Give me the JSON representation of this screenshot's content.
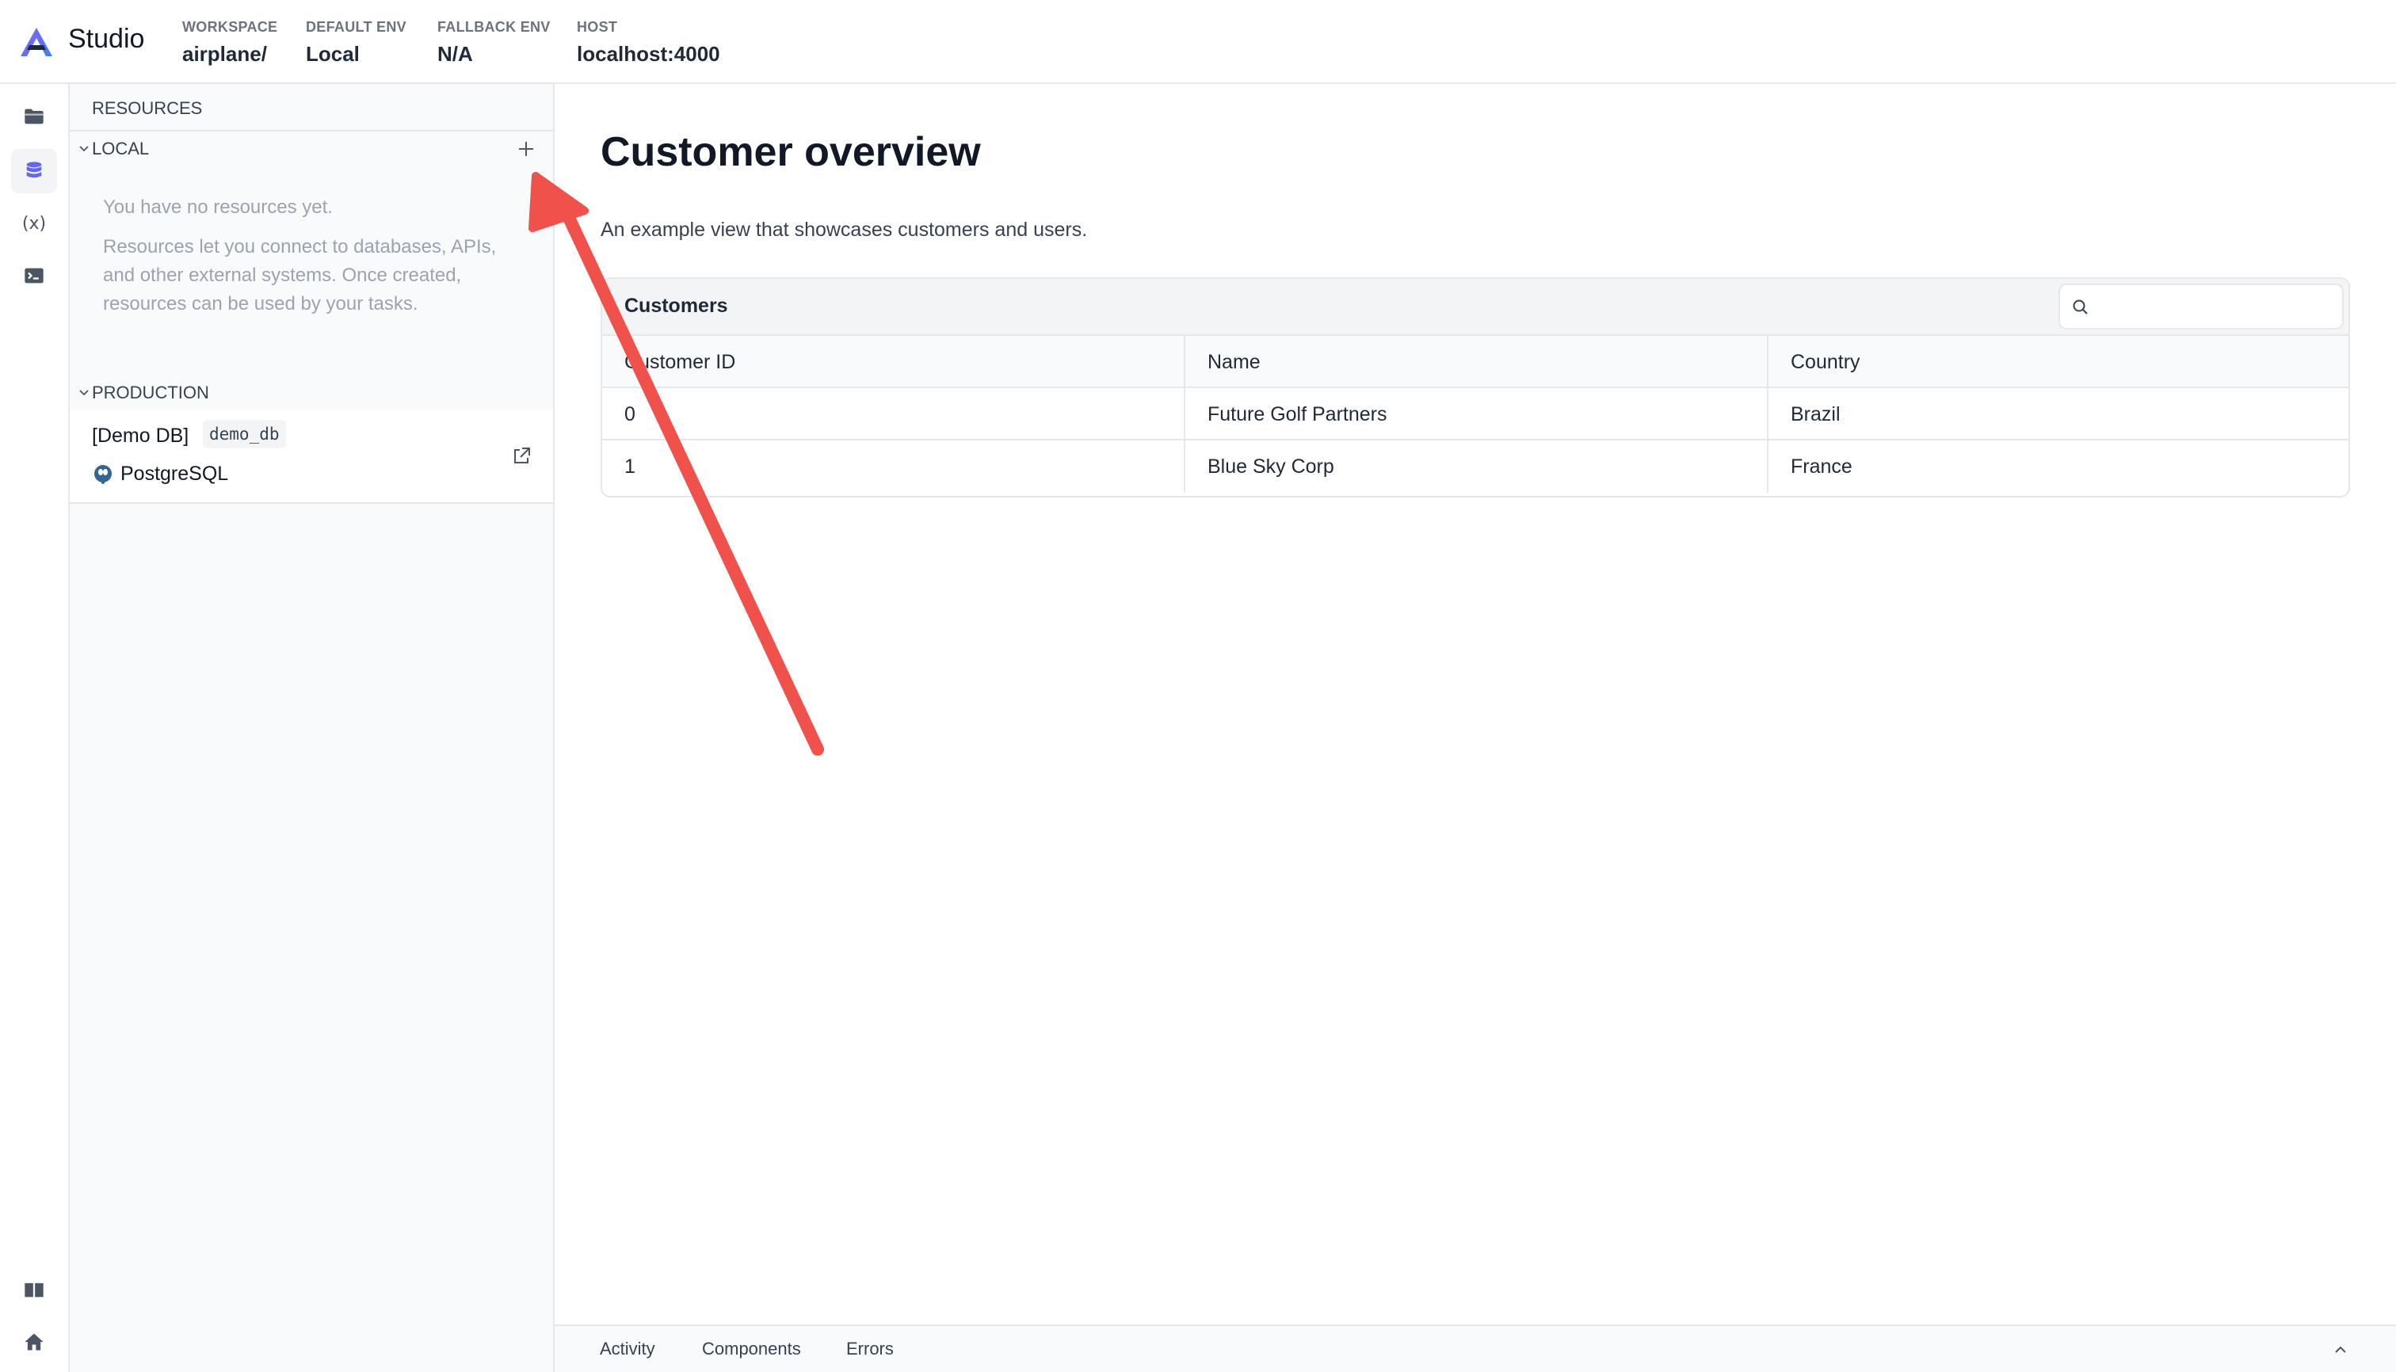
{
  "header": {
    "app_title": "Studio",
    "meta": [
      {
        "label": "WORKSPACE",
        "value": "airplane/"
      },
      {
        "label": "DEFAULT ENV",
        "value": "Local"
      },
      {
        "label": "FALLBACK ENV",
        "value": "N/A"
      },
      {
        "label": "HOST",
        "value": "localhost:4000"
      }
    ]
  },
  "rail": {
    "items": [
      {
        "icon": "folder-icon",
        "active": false
      },
      {
        "icon": "database-icon",
        "active": true
      },
      {
        "icon": "variable-icon",
        "label": "(x)",
        "active": false
      },
      {
        "icon": "terminal-icon",
        "active": false
      }
    ],
    "bottom_items": [
      {
        "icon": "book-icon"
      },
      {
        "icon": "home-icon"
      }
    ]
  },
  "resources": {
    "title": "RESOURCES",
    "local": {
      "label": "LOCAL",
      "empty_title": "You have no resources yet.",
      "empty_body": "Resources let you connect to databases, APIs, and other external systems. Once created, resources can be used by your tasks."
    },
    "production": {
      "label": "PRODUCTION",
      "items": [
        {
          "name": "[Demo DB]",
          "slug": "demo_db",
          "type": "PostgreSQL"
        }
      ]
    }
  },
  "main": {
    "title": "Customer overview",
    "description": "An example view that showcases customers and users.",
    "table": {
      "title": "Customers",
      "search_placeholder": "",
      "columns": [
        "Customer ID",
        "Name",
        "Country"
      ],
      "rows": [
        [
          "0",
          "Future Golf Partners",
          "Brazil"
        ],
        [
          "1",
          "Blue Sky Corp",
          "France"
        ]
      ]
    }
  },
  "bottom_bar": {
    "tabs": [
      "Activity",
      "Components",
      "Errors"
    ]
  },
  "colors": {
    "accent": "#6366f1",
    "annotation_arrow": "#f0514a"
  }
}
